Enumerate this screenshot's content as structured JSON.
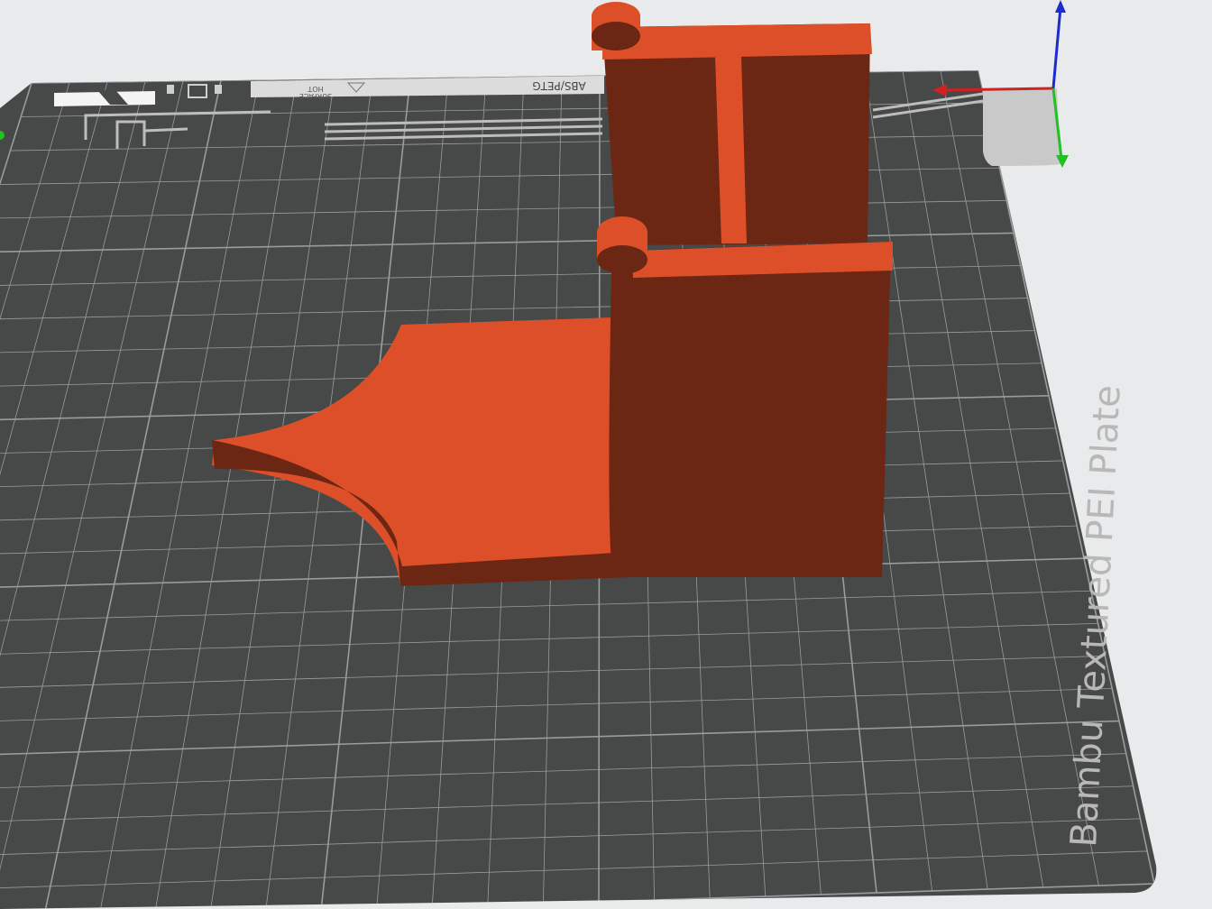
{
  "viewport": {
    "background_color": "#e9eaeb",
    "plate": {
      "name": "Bambu Textured PEI Plate",
      "color": "#474848",
      "grid_color": "#9a9c9c",
      "header_text": {
        "filament": "ABS/PETG",
        "hot_line1": "HOT",
        "hot_line2": "SURFACE"
      }
    },
    "model": {
      "face_color": "#dd4f28",
      "side_color": "#6b2614"
    },
    "axes": {
      "x_color": "#d32020",
      "y_color": "#22c022",
      "z_color": "#1a2bd0"
    }
  }
}
